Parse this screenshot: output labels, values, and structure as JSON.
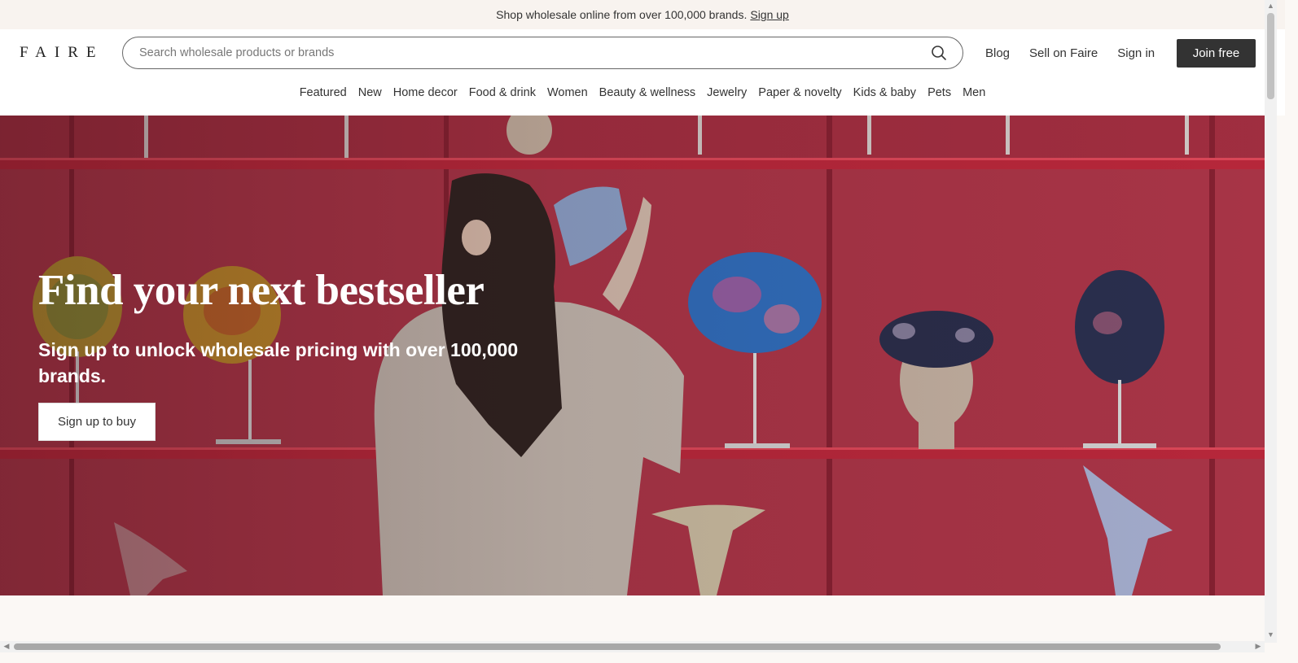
{
  "announcement": {
    "text": "Shop wholesale online from over 100,000 brands.",
    "link": "Sign up"
  },
  "header": {
    "logo": "FAIRE",
    "search": {
      "placeholder": "Search wholesale products or brands",
      "icon": "search-icon"
    },
    "links": [
      "Blog",
      "Sell on Faire",
      "Sign in"
    ],
    "join_button": "Join free"
  },
  "categories": [
    "Featured",
    "New",
    "Home decor",
    "Food & drink",
    "Women",
    "Beauty & wellness",
    "Jewelry",
    "Paper & novelty",
    "Kids & baby",
    "Pets",
    "Men"
  ],
  "hero": {
    "title": "Find your next bestseller",
    "subtitle": "Sign up to unlock wholesale pricing with over 100,000 brands.",
    "button": "Sign up to buy"
  },
  "colors": {
    "primary_button": "#333333",
    "hero_background": "#b53848",
    "page_background": "#fbf8f5"
  }
}
